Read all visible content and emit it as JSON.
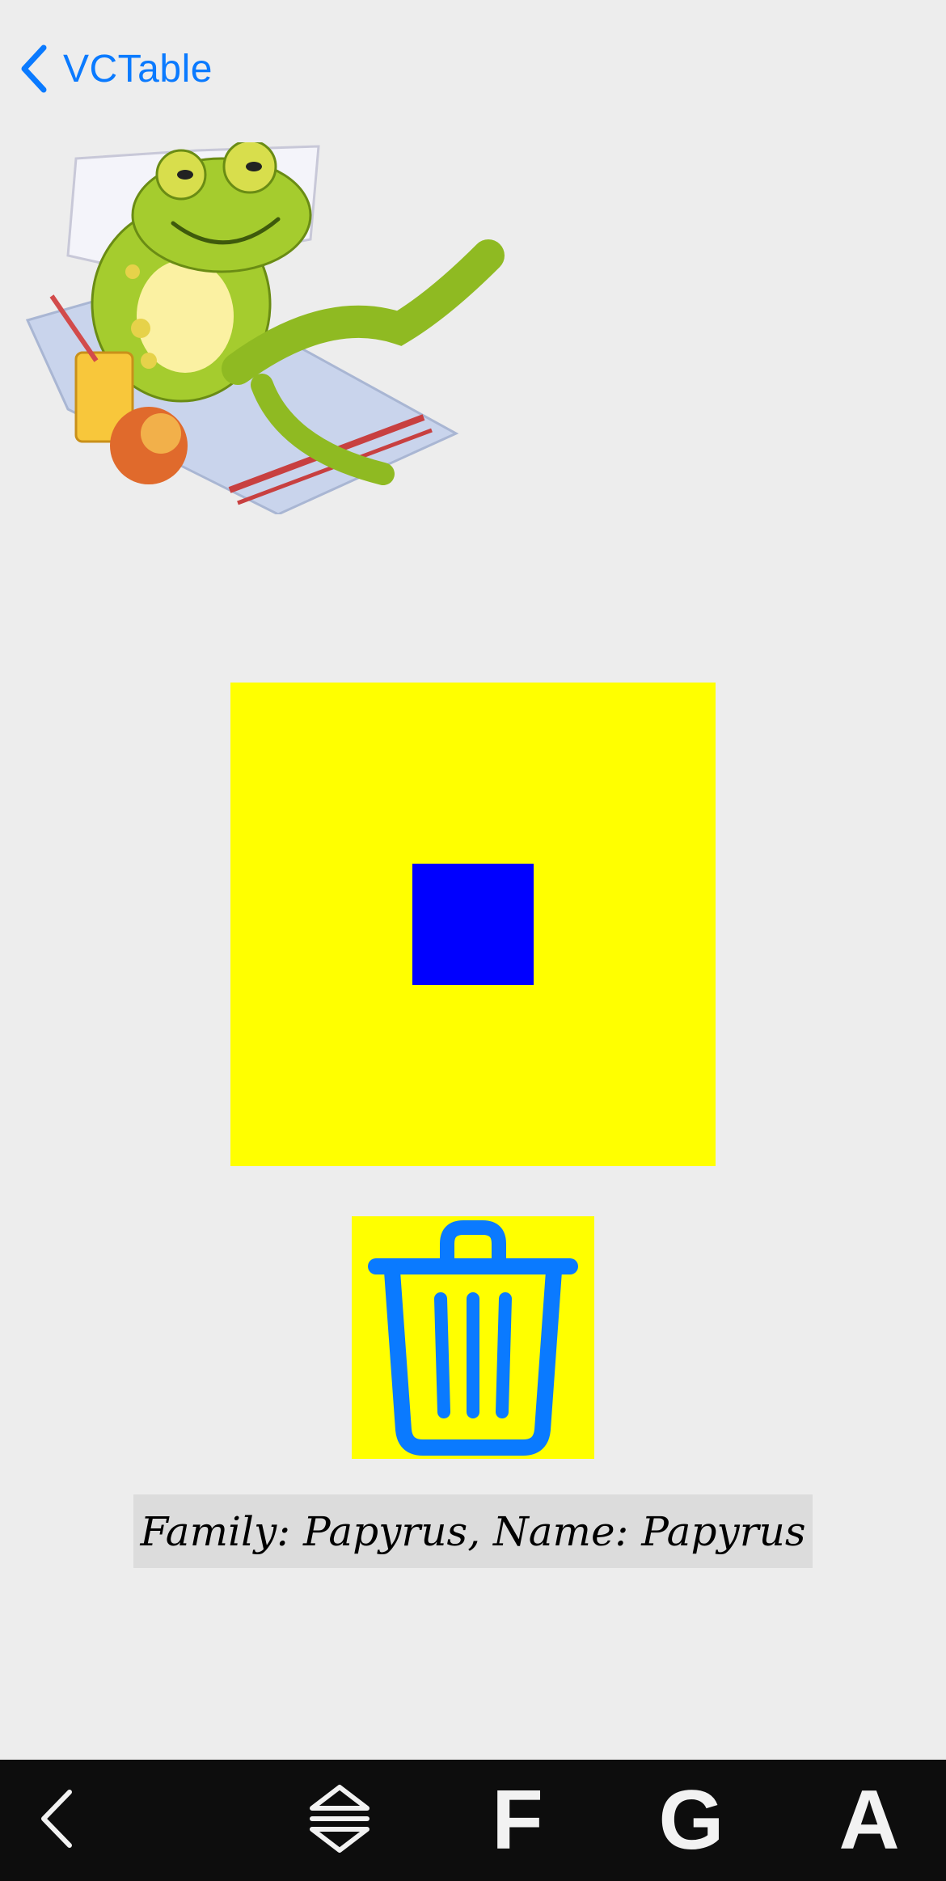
{
  "nav": {
    "back_label": "VCTable",
    "back_icon": "chevron-left-icon",
    "accent_color": "#0a7aff"
  },
  "image": {
    "subject": "frog-illustration"
  },
  "canvas": {
    "outer_color": "#ffff00",
    "inner_color": "#0000ff"
  },
  "trash_button": {
    "icon": "trash-icon",
    "background": "#ffff00"
  },
  "font_label": {
    "text": "Family: Papyrus, Name: Papyrus"
  },
  "toolbar": {
    "back_icon": "chevron-left-icon",
    "expand_icon": "expand-collapse-icon",
    "f_label": "F",
    "g_label": "G",
    "a_label": "A"
  }
}
